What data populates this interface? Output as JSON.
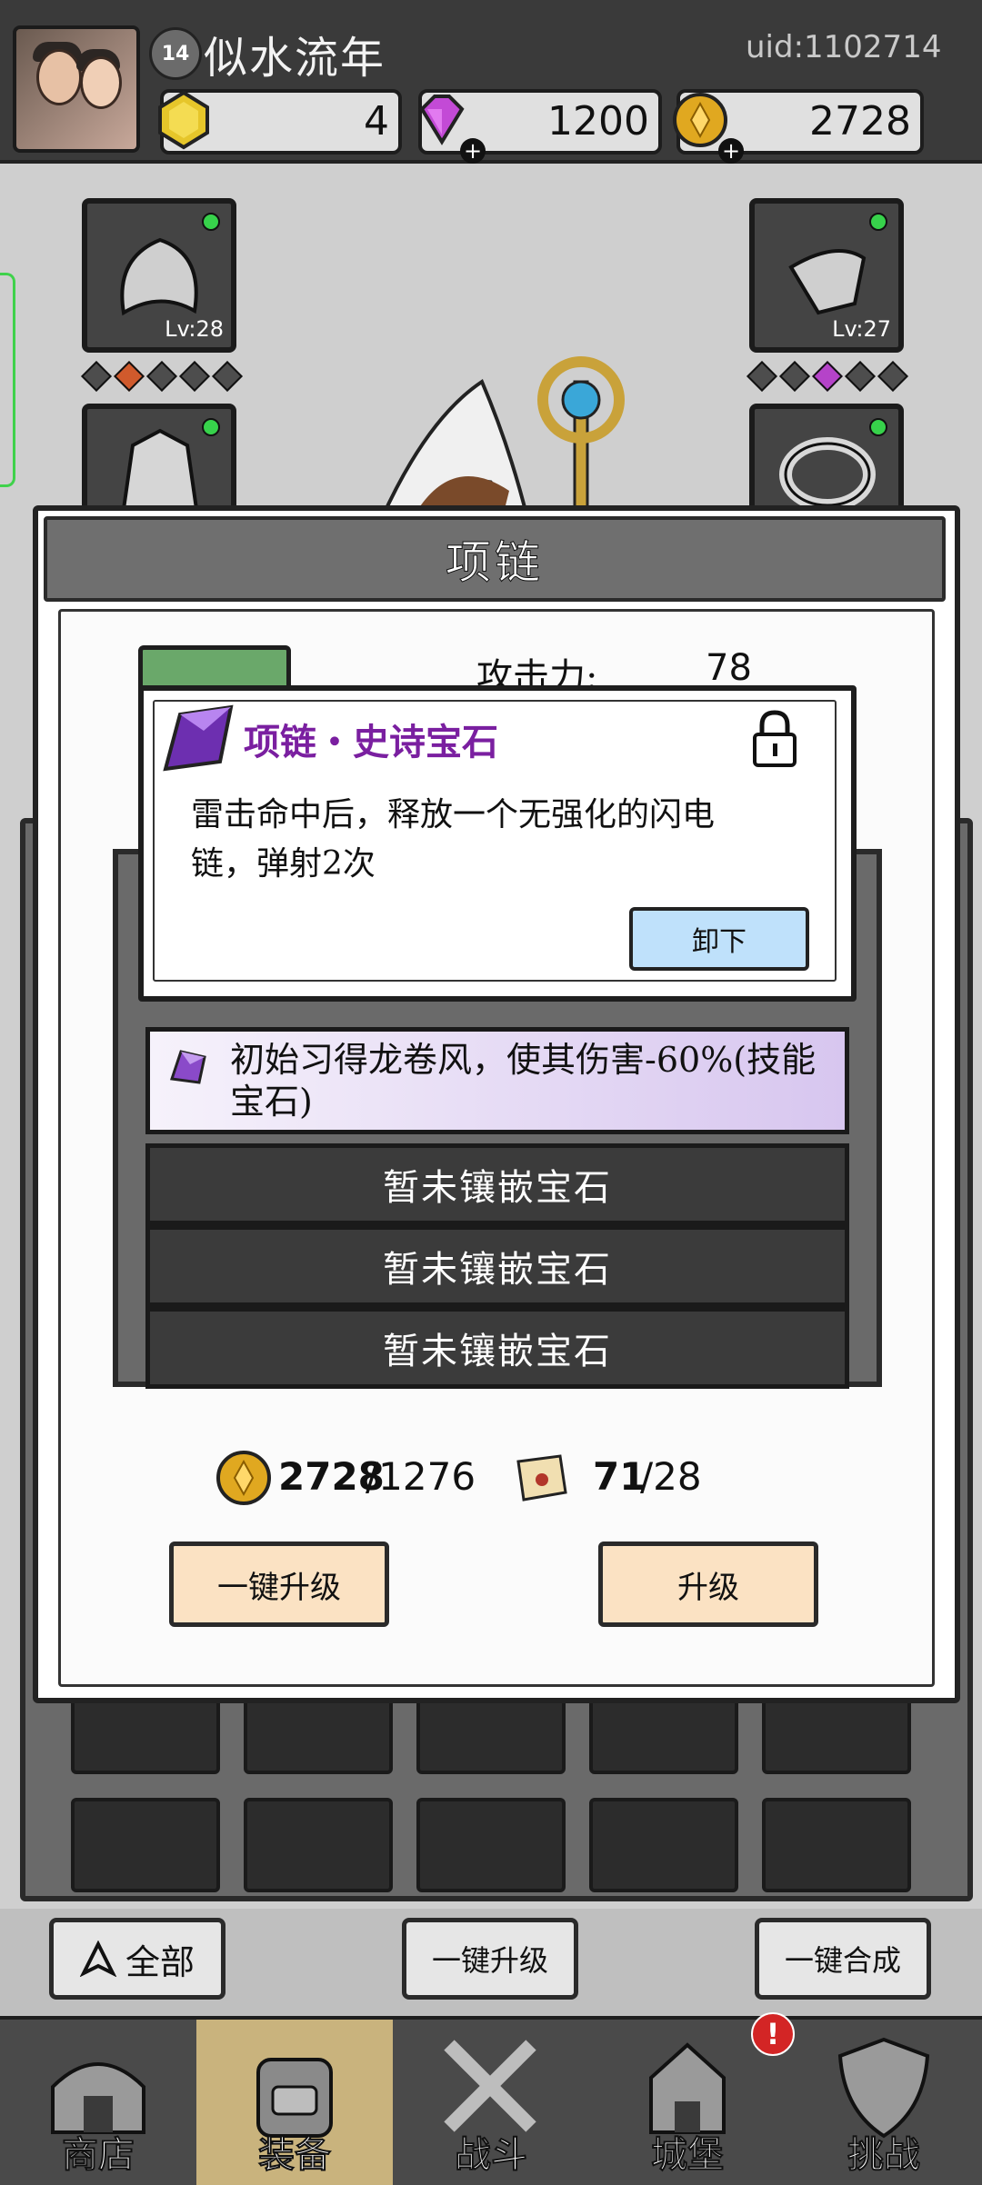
{
  "header": {
    "level": "14",
    "player_name": "似水流年",
    "uid": "uid:1102714",
    "resources": [
      {
        "name": "gold-gem",
        "value": "4"
      },
      {
        "name": "diamond",
        "value": "1200"
      },
      {
        "name": "coin",
        "value": "2728"
      }
    ]
  },
  "equipment": {
    "helmet_level": "Lv:28",
    "gloves_level": "Lv:27"
  },
  "dialog": {
    "title": "项链",
    "attack_label": "攻击力:",
    "attack_value": "78",
    "slots": {
      "filled_text": "初始习得龙卷风，使其伤害-60%(技能宝石)",
      "empty_1": "暂未镶嵌宝石",
      "empty_2": "暂未镶嵌宝石",
      "empty_3": "暂未镶嵌宝石"
    },
    "cost": {
      "gold_have": "2728",
      "gold_need": "/1276",
      "scroll_have": "71",
      "scroll_need": "/28"
    },
    "buttons": {
      "one_click_upgrade": "一键升级",
      "upgrade": "升级"
    }
  },
  "popup": {
    "title": "项链・史诗宝石",
    "description": "雷击命中后，释放一个无强化的闪电链，弹射2次",
    "unload_button": "卸下"
  },
  "actions": {
    "filter": "全部",
    "one_click_upgrade": "一键升级",
    "one_click_merge": "一键合成"
  },
  "nav": {
    "shop": "商店",
    "equipment": "装备",
    "battle": "战斗",
    "castle": "城堡",
    "challenge": "挑战"
  },
  "colors": {
    "epic_purple": "#7a1fa0",
    "have_green": "#2f7a21",
    "nav_active": "#c9b37d"
  }
}
